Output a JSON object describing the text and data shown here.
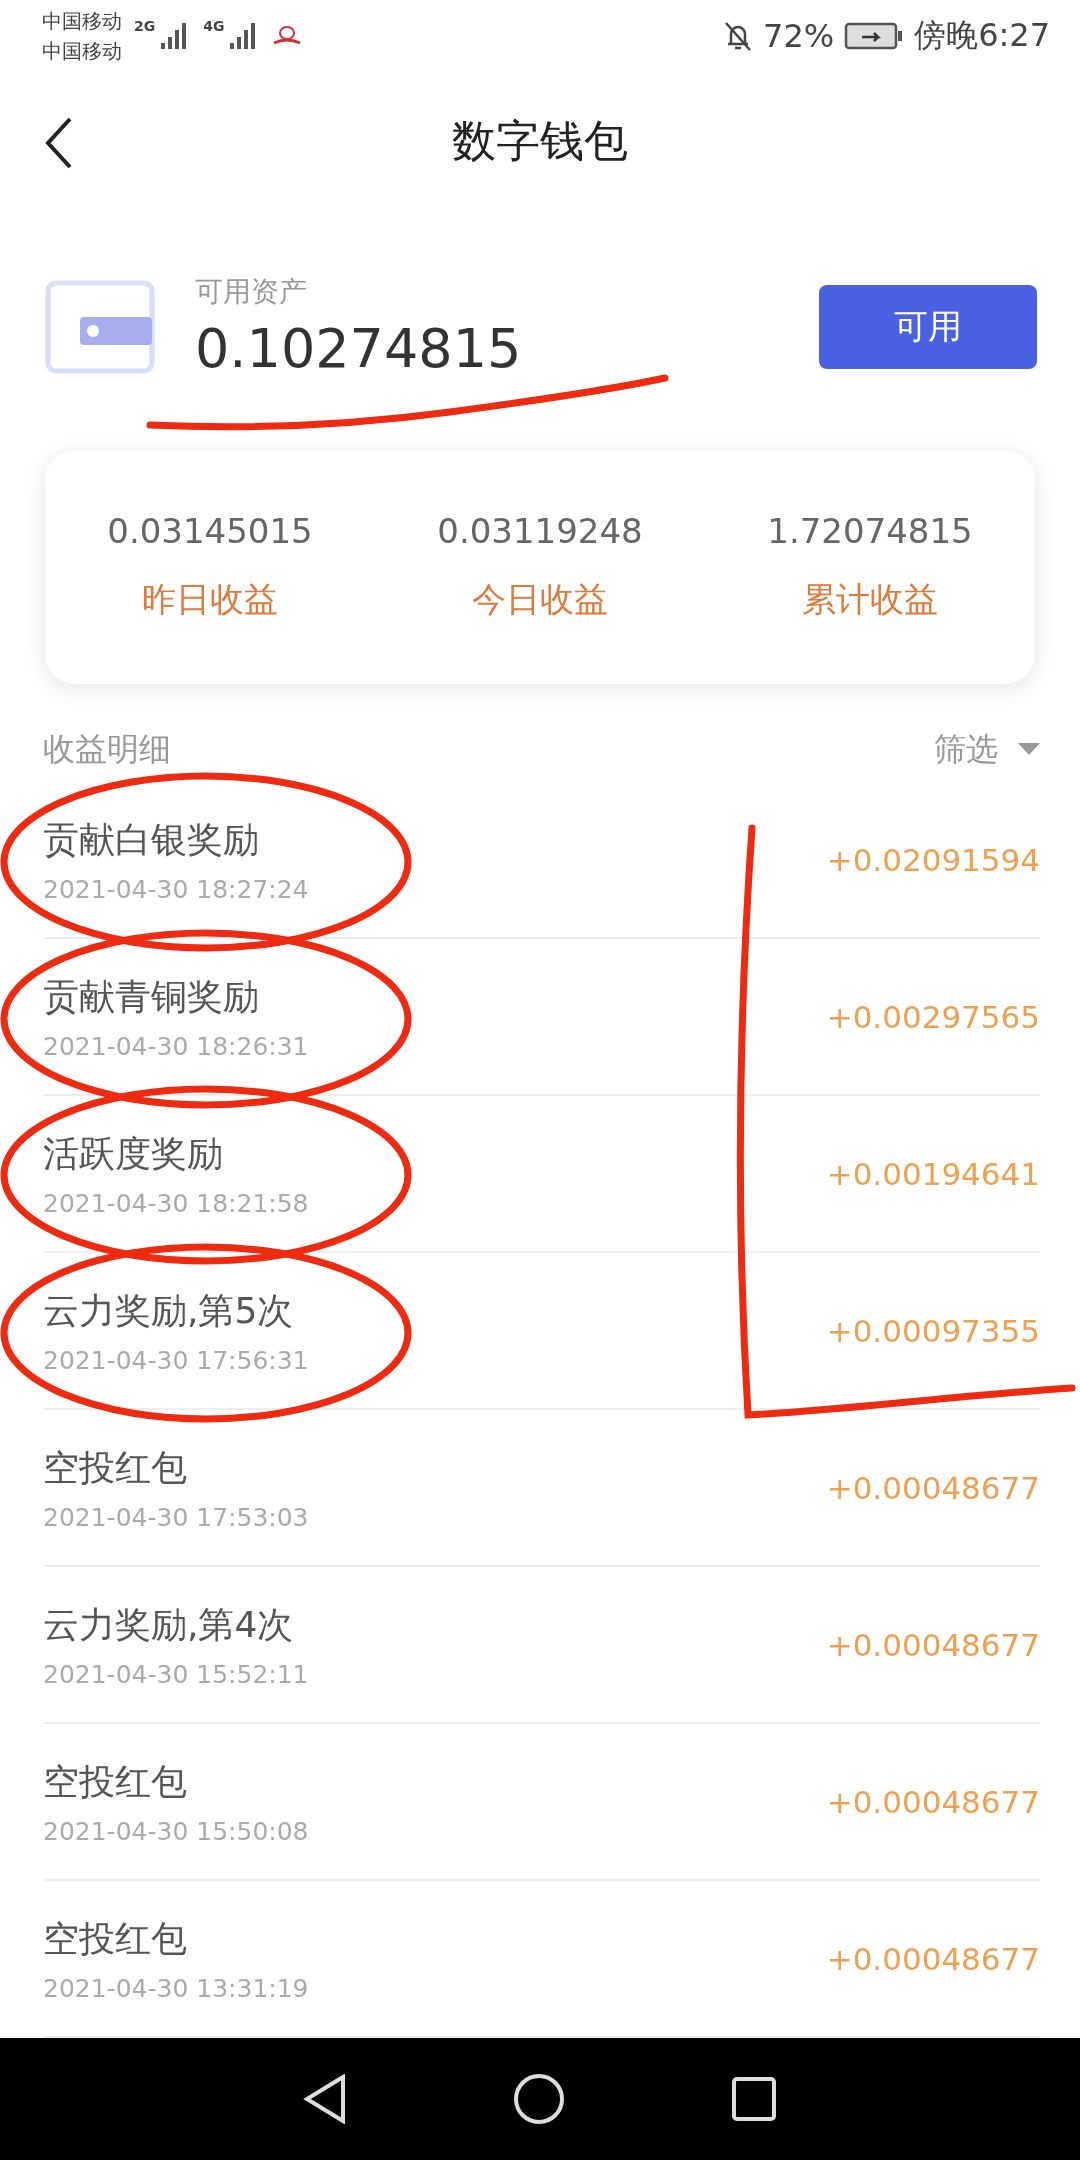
{
  "status_bar": {
    "carriers": [
      "中国移动",
      "中国移动"
    ],
    "networks": [
      "2G",
      "4G"
    ],
    "battery": "72%",
    "time": "傍晚6:27"
  },
  "header": {
    "title": "数字钱包"
  },
  "asset": {
    "label": "可用资产",
    "amount": "0.10274815",
    "button": "可用"
  },
  "stats": [
    {
      "value": "0.03145015",
      "label": "昨日收益"
    },
    {
      "value": "0.03119248",
      "label": "今日收益"
    },
    {
      "value": "1.72074815",
      "label": "累计收益"
    }
  ],
  "details": {
    "title": "收益明细",
    "filter": "筛选"
  },
  "records": [
    {
      "title": "贡献白银奖励",
      "time": "2021-04-30 18:27:24",
      "amount": "+0.02091594"
    },
    {
      "title": "贡献青铜奖励",
      "time": "2021-04-30 18:26:31",
      "amount": "+0.00297565"
    },
    {
      "title": "活跃度奖励",
      "time": "2021-04-30 18:21:58",
      "amount": "+0.00194641"
    },
    {
      "title": "云力奖励,第5次",
      "time": "2021-04-30 17:56:31",
      "amount": "+0.00097355"
    },
    {
      "title": "空投红包",
      "time": "2021-04-30 17:53:03",
      "amount": "+0.00048677"
    },
    {
      "title": "云力奖励,第4次",
      "time": "2021-04-30 15:52:11",
      "amount": "+0.00048677"
    },
    {
      "title": "空投红包",
      "time": "2021-04-30 15:50:08",
      "amount": "+0.00048677"
    },
    {
      "title": "空投红包",
      "time": "2021-04-30 13:31:19",
      "amount": "+0.00048677"
    }
  ]
}
